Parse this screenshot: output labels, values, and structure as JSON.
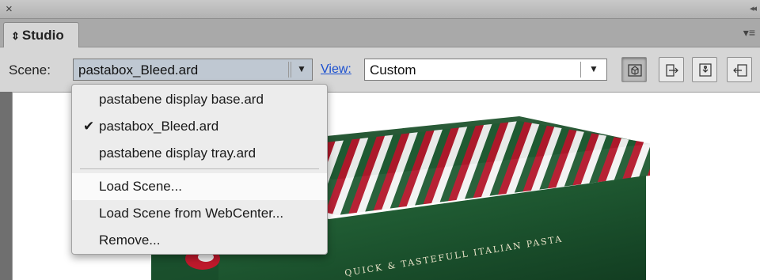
{
  "panel": {
    "close_icon": "×",
    "collapse_icon": "◂◂",
    "tab_title": "Studio",
    "tab_icon": "⇕",
    "menu_icon": "▾≡"
  },
  "toolbar": {
    "scene_label": "Scene:",
    "scene_value": "pastabox_Bleed.ard",
    "view_link": "View:",
    "view_value": "Custom",
    "buttons": [
      "3d-view-icon",
      "export-icon",
      "render-icon",
      "settings-icon"
    ]
  },
  "scene_menu": {
    "items": [
      {
        "label": "pastabene display base.ard",
        "checked": false
      },
      {
        "label": "pastabox_Bleed.ard",
        "checked": true
      },
      {
        "label": "pastabene display tray.ard",
        "checked": false
      }
    ],
    "actions": [
      {
        "label": "Load Scene..."
      },
      {
        "label": "Load Scene from WebCenter..."
      },
      {
        "label": "Remove..."
      }
    ],
    "check_glyph": "✔"
  },
  "scene_render": {
    "box_text": "QUICK & TASTEFULL ITALIAN PASTA",
    "colors": {
      "box_green": "#1f5a32",
      "stripe_red": "#b3162a",
      "stripe_white": "#f2f2f2"
    }
  }
}
